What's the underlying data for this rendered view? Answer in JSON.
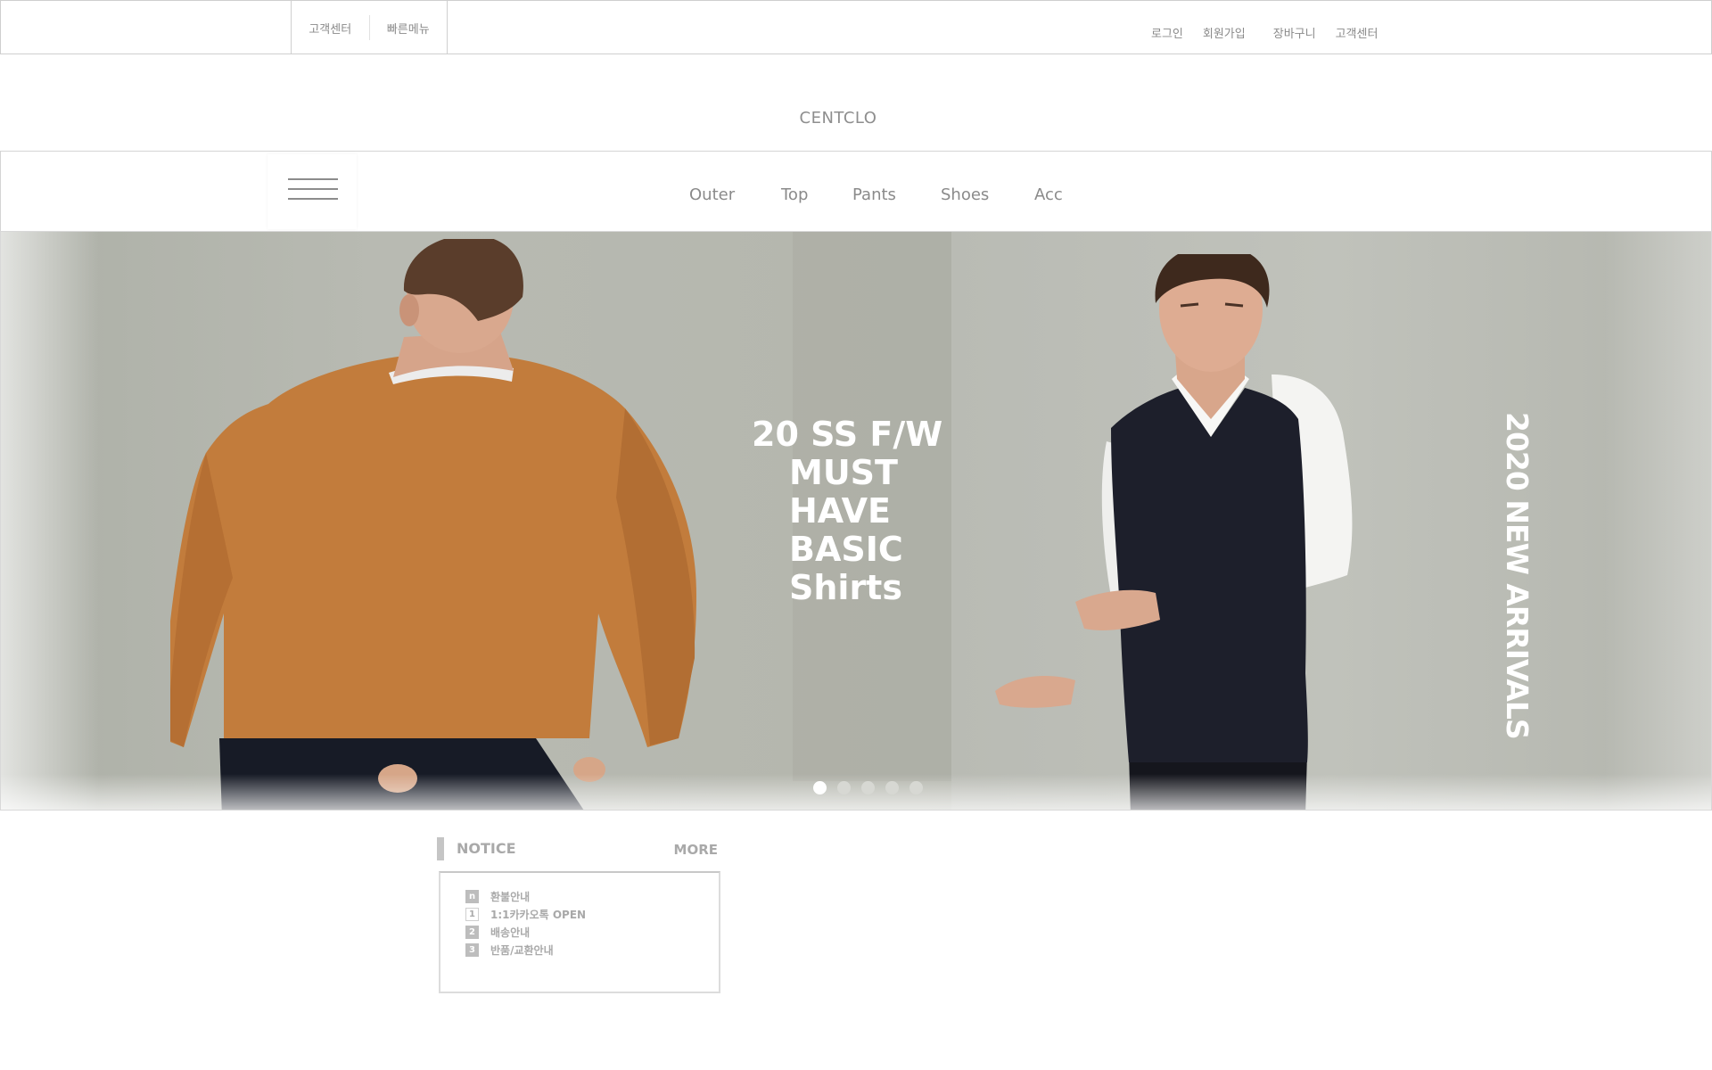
{
  "topbar": {
    "left_links": [
      "고객센터",
      "빠른메뉴"
    ],
    "right_links": [
      "로그인",
      "회원가입",
      "장바구니",
      "고객센터"
    ]
  },
  "brand": {
    "logo_text": "CENTCLO"
  },
  "nav": {
    "menu_icon": "hamburger-icon",
    "items": [
      "Outer",
      "Top",
      "Pants",
      "Shoes",
      "Acc"
    ]
  },
  "hero": {
    "title_lines": [
      "20 SS F/W",
      "MUST",
      "HAVE",
      "BASIC",
      "Shirts"
    ],
    "vertical_text": "2020 NEW ARRIVALS",
    "slide_count": 5,
    "active_slide": 1
  },
  "notice": {
    "heading": "NOTICE",
    "more_label": "MORE",
    "items": [
      {
        "badge": "n",
        "text": "환불안내"
      },
      {
        "badge": "1",
        "text": "1:1카카오톡 OPEN"
      },
      {
        "badge": "2",
        "text": "배송안내"
      },
      {
        "badge": "3",
        "text": "반품/교환안내"
      }
    ]
  },
  "colors": {
    "hero_background": "#b4b6ae",
    "text_muted": "#8a8a8a",
    "sweater_orange": "#c27c3c",
    "vest_navy": "#1d1f2b"
  }
}
